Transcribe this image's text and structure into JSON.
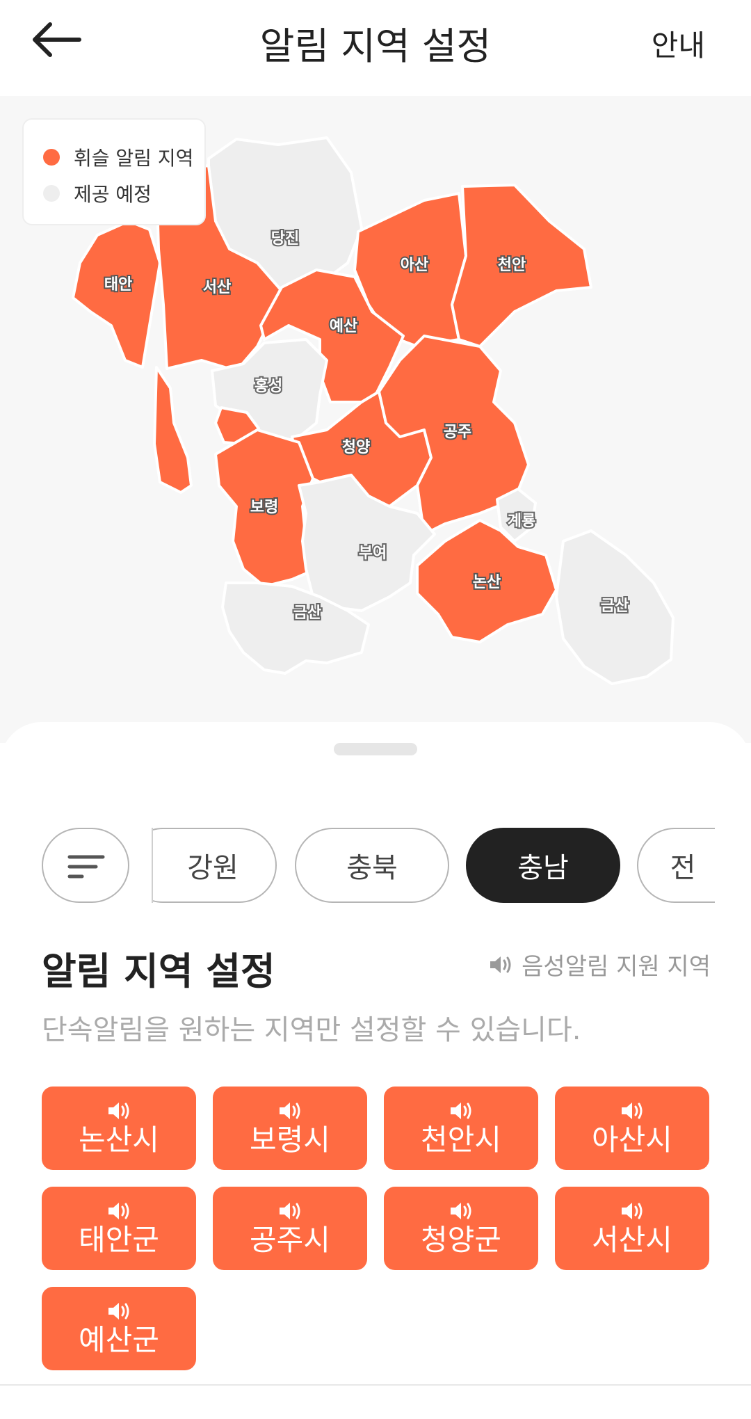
{
  "header": {
    "title": "알림 지역 설정",
    "guide_label": "안내"
  },
  "legend": {
    "active_label": "휘슬 알림 지역",
    "planned_label": "제공 예정",
    "active_color": "#ff6b42",
    "planned_color": "#eeeeee"
  },
  "map": {
    "active_regions": [
      "태안",
      "서산",
      "아산",
      "천안",
      "예산",
      "청양",
      "공주",
      "보령",
      "논산"
    ],
    "planned_regions": [
      "당진",
      "홍성",
      "부여",
      "계룡",
      "금산",
      "금산"
    ]
  },
  "province_tabs": {
    "items": [
      "강원",
      "충북",
      "충남",
      "전"
    ],
    "selected": "충남"
  },
  "section": {
    "title": "알림 지역 설정",
    "voice_legend": "음성알림 지원 지역",
    "description": "단속알림을 원하는 지역만 설정할 수 있습니다."
  },
  "regions": [
    "논산시",
    "보령시",
    "천안시",
    "아산시",
    "태안군",
    "공주시",
    "청양군",
    "서산시",
    "예산군"
  ],
  "colors": {
    "accent": "#ff6b42",
    "dark": "#222222",
    "muted": "#aaaaaa"
  }
}
